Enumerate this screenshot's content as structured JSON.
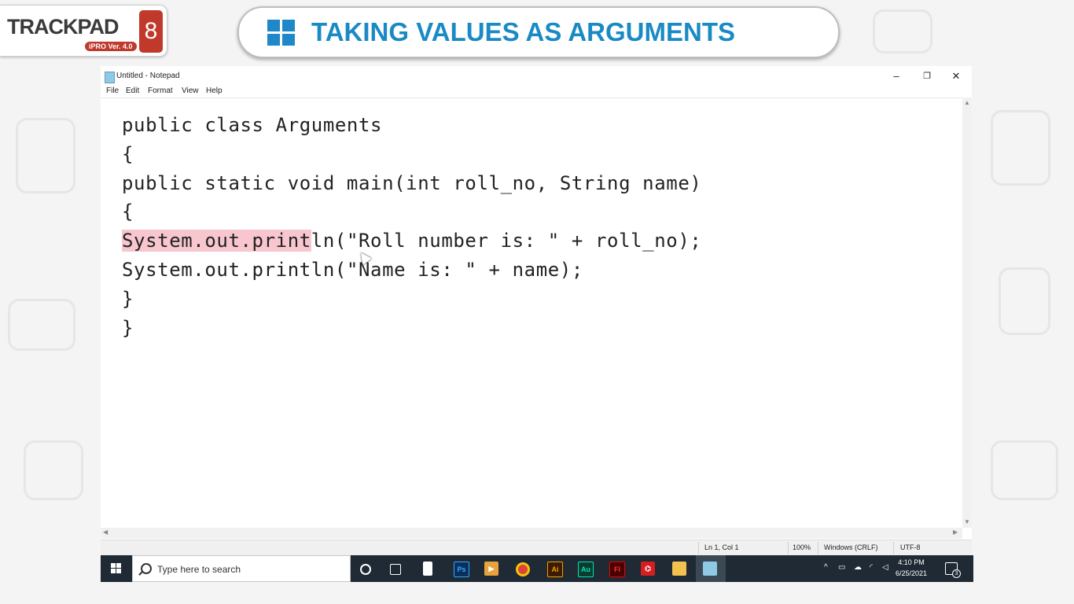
{
  "logo": {
    "brand": "TRACKPAD",
    "version": "iPRO Ver. 4.0",
    "number": "8"
  },
  "banner": {
    "title": "TAKING VALUES AS ARGUMENTS"
  },
  "notepad": {
    "title": "Untitled - Notepad",
    "menu": [
      "File",
      "Edit",
      "Format",
      "View",
      "Help"
    ],
    "window_controls": {
      "minimize": "–",
      "maximize": "❐",
      "close": "✕"
    },
    "code": [
      "public class Arguments",
      "{",
      "public static void main(int roll_no, String name)",
      "{",
      "System.out.println(\"Roll number is: \" + roll_no);",
      "System.out.println(\"Name is: \" + name);",
      "}",
      "}"
    ],
    "highlight_text": "System.out.print",
    "highlight_rest": "ln(\"Roll number is: \" + roll_no);",
    "status": {
      "position": "Ln 1, Col 1",
      "zoom": "100%",
      "line_ending": "Windows (CRLF)",
      "encoding": "UTF-8"
    }
  },
  "taskbar": {
    "search_placeholder": "Type here to search",
    "apps": [
      "cortana",
      "task-view",
      "file",
      "photoshop",
      "media",
      "chrome",
      "illustrator",
      "audition",
      "flash",
      "acrobat",
      "file-explorer",
      "notepad"
    ],
    "labels": {
      "ps": "Ps",
      "ai": "Ai",
      "au": "Au",
      "fl": "Fl"
    },
    "clock_time": "4:10 PM",
    "clock_date": "6/25/2021",
    "notification_count": "3"
  },
  "colors": {
    "banner_text": "#1a8ac4",
    "highlight": "#f7c6cf",
    "taskbar": "#1f2a34",
    "logo_red": "#c0392b"
  }
}
